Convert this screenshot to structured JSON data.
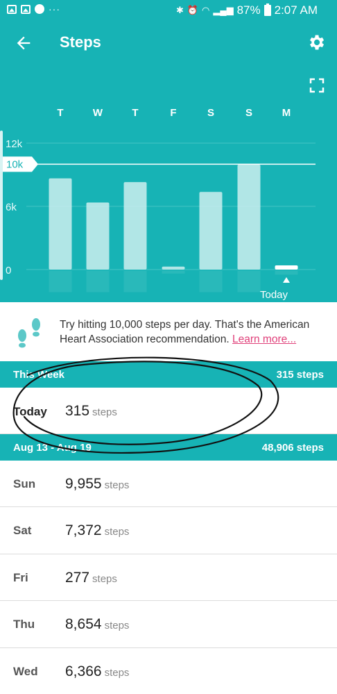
{
  "status_bar": {
    "battery": "87%",
    "time": "2:07 AM",
    "overflow": "···"
  },
  "app_bar": {
    "title": "Steps",
    "back_icon": "arrow-left-icon",
    "settings_icon": "gear-icon",
    "expand_icon": "fullscreen-icon"
  },
  "chart_data": {
    "type": "bar",
    "categories": [
      "T",
      "W",
      "T",
      "F",
      "S",
      "S",
      "M"
    ],
    "values": [
      8654,
      6366,
      8300,
      277,
      7372,
      9955,
      315
    ],
    "ylim": [
      0,
      12000
    ],
    "y_ticks": [
      {
        "label": "12k",
        "value": 12000
      },
      {
        "label": "6k",
        "value": 6000
      },
      {
        "label": "0",
        "value": 0
      }
    ],
    "goal": {
      "label": "10k",
      "value": 10000
    },
    "today_label": "Today",
    "today_index": 6,
    "grid": true,
    "colors": {
      "bar": "#cdeeee",
      "today_bar": "#ffffff",
      "goal_line": "#ffffff"
    }
  },
  "tip": {
    "text": "Try hitting 10,000 steps per day. That's the American Heart Association recommendation. ",
    "link": "Learn more..."
  },
  "this_week": {
    "label": "This Week",
    "total": "315 steps",
    "rows": [
      {
        "day": "Today",
        "value": "315",
        "unit": "steps"
      }
    ]
  },
  "last_week": {
    "label": "Aug 13 - Aug 19",
    "total": "48,906 steps",
    "rows": [
      {
        "day": "Sun",
        "value": "9,955",
        "unit": "steps"
      },
      {
        "day": "Sat",
        "value": "7,372",
        "unit": "steps"
      },
      {
        "day": "Fri",
        "value": "277",
        "unit": "steps"
      },
      {
        "day": "Thu",
        "value": "8,654",
        "unit": "steps"
      },
      {
        "day": "Wed",
        "value": "6,366",
        "unit": "steps"
      }
    ]
  },
  "colors": {
    "accent": "#17b3b5",
    "link": "#e0407a",
    "feet": "#5cc8c8"
  }
}
